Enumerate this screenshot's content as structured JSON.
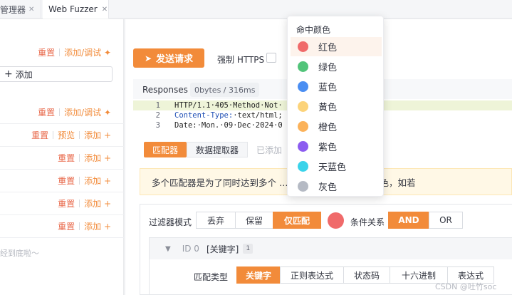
{
  "tabs": [
    {
      "label": "管理器"
    },
    {
      "label": "Web Fuzzer"
    }
  ],
  "left": {
    "reset": "重置",
    "debug_label": "添加/调试",
    "add_label": "添加",
    "preview": "预览",
    "add_box": "添加",
    "bottom_text": "经到底啦～"
  },
  "main": {
    "send_button": "发送请求",
    "force_https": "强制 HTTPS",
    "responses_label": "Responses",
    "responses_badge": "0bytes / 316ms",
    "code": [
      {
        "n": "1",
        "text": "HTTP/1.1·405·Method·Not·"
      },
      {
        "n": "2",
        "key": "Content-Type:",
        "text": "·text/html;"
      },
      {
        "n": "3",
        "text": "Date:·Mon,·09·Dec·2024·0"
      }
    ],
    "subtabs": [
      "匹配器",
      "数据提取器",
      "已添加"
    ],
    "tip": "多个匹配器是为了同时达到多个 … 同颜色或丢包的同时染色，如若",
    "filter_mode_label": "过滤器模式",
    "filter_modes": [
      "丢弃",
      "保留",
      "仅匹配"
    ],
    "condition_label": "条件关系",
    "conditions": [
      "AND",
      "OR"
    ],
    "matcher_id": "ID 0",
    "matcher_kind": "[关键字]",
    "matcher_count": "1",
    "match_type_label": "匹配类型",
    "match_types": [
      "关键字",
      "正则表达式",
      "状态码",
      "十六进制",
      "表达式"
    ]
  },
  "dropdown": {
    "title": "命中颜色",
    "items": [
      {
        "label": "红色",
        "color": "#f06a6a"
      },
      {
        "label": "绿色",
        "color": "#52c47a"
      },
      {
        "label": "蓝色",
        "color": "#4a8ef2"
      },
      {
        "label": "黄色",
        "color": "#fcd37a"
      },
      {
        "label": "橙色",
        "color": "#fbb25a"
      },
      {
        "label": "紫色",
        "color": "#8c5cf0"
      },
      {
        "label": "天蓝色",
        "color": "#3ad3ea"
      },
      {
        "label": "灰色",
        "color": "#b5bac4"
      }
    ]
  },
  "watermark": "CSDN @吐竹soc"
}
